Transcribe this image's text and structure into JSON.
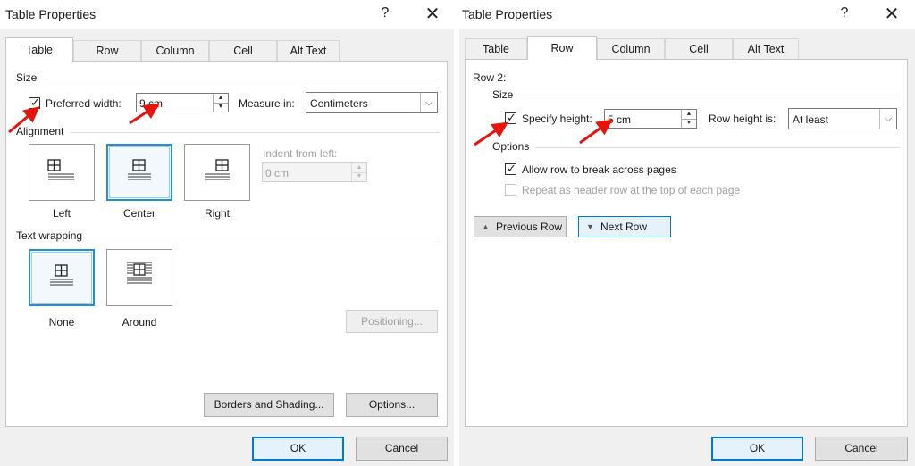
{
  "dialog_left": {
    "title": "Table Properties",
    "help": "?",
    "close": "✕",
    "tabs": [
      "Table",
      "Row",
      "Column",
      "Cell",
      "Alt Text"
    ],
    "active_tab": "Table",
    "size": {
      "group": "Size",
      "preferred_width_label": "Preferred width:",
      "preferred_width_checked": true,
      "preferred_width_value": "9 cm",
      "measure_in_label": "Measure in:",
      "measure_in_value": "Centimeters"
    },
    "alignment": {
      "group": "Alignment",
      "options": [
        "Left",
        "Center",
        "Right"
      ],
      "selected": "Center",
      "indent_label": "Indent from left:",
      "indent_value": "0 cm"
    },
    "text_wrapping": {
      "group": "Text wrapping",
      "options": [
        "None",
        "Around"
      ],
      "selected": "None",
      "positioning_button": "Positioning..."
    },
    "borders_button": "Borders and Shading...",
    "options_button": "Options...",
    "ok_button": "OK",
    "cancel_button": "Cancel"
  },
  "dialog_right": {
    "title": "Table Properties",
    "help": "?",
    "close": "✕",
    "tabs": [
      "Table",
      "Row",
      "Column",
      "Cell",
      "Alt Text"
    ],
    "active_tab": "Row",
    "row_label": "Row 2:",
    "size": {
      "group": "Size",
      "specify_height_label": "Specify height:",
      "specify_height_checked": true,
      "height_value": "5 cm",
      "row_height_is_label": "Row height is:",
      "row_height_is_value": "At least"
    },
    "options": {
      "group": "Options",
      "allow_break_label": "Allow row to break across pages",
      "allow_break_checked": true,
      "repeat_header_label": "Repeat as header row at the top of each page",
      "repeat_header_checked": false
    },
    "previous_row_button": "Previous Row",
    "next_row_button": "Next Row",
    "ok_button": "OK",
    "cancel_button": "Cancel"
  },
  "colors": {
    "accent": "#0078d7",
    "annotation_arrow": "#e8140c"
  }
}
